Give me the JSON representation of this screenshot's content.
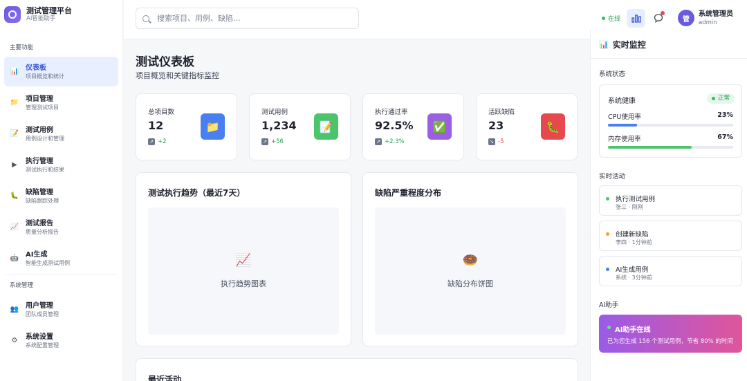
{
  "brand": {
    "title": "测试管理平台",
    "subtitle": "AI智能助手"
  },
  "sidebar": {
    "section_main": "主要功能",
    "section_system": "系统管理",
    "items": [
      {
        "label": "仪表板",
        "desc": "项目概览和统计",
        "icon": "📊",
        "active": true
      },
      {
        "label": "项目管理",
        "desc": "管理测试项目",
        "icon": "📁"
      },
      {
        "label": "测试用例",
        "desc": "用例设计和管理",
        "icon": "📝"
      },
      {
        "label": "执行管理",
        "desc": "测试执行和结果",
        "icon": "▶"
      },
      {
        "label": "缺陷管理",
        "desc": "缺陷跟踪处理",
        "icon": "🐛"
      },
      {
        "label": "测试报告",
        "desc": "质量分析报告",
        "icon": "📈"
      },
      {
        "label": "AI生成",
        "desc": "智能生成测试用例",
        "icon": "🤖"
      }
    ],
    "system_items": [
      {
        "label": "用户管理",
        "desc": "团队成员管理",
        "icon": "👥"
      },
      {
        "label": "系统设置",
        "desc": "系统配置管理",
        "icon": "⚙"
      }
    ]
  },
  "header": {
    "search_placeholder": "搜索项目、用例、缺陷...",
    "status": "在线",
    "user_name": "系统管理员",
    "user_role": "admin",
    "avatar_text": "管"
  },
  "main": {
    "title": "测试仪表板",
    "subtitle": "项目概览和关键指标监控",
    "stats": [
      {
        "label": "总项目数",
        "value": "12",
        "trend": "+2",
        "trend_color": "#2a9b54",
        "icon": "📁",
        "icon_bg": "#4a7ff0"
      },
      {
        "label": "测试用例",
        "value": "1,234",
        "trend": "+56",
        "trend_color": "#2a9b54",
        "icon": "📝",
        "icon_bg": "#4cc46a"
      },
      {
        "label": "执行通过率",
        "value": "92.5%",
        "trend": "+2.3%",
        "trend_color": "#2a9b54",
        "icon": "✅",
        "icon_bg": "#9b5fe6"
      },
      {
        "label": "活跃缺陷",
        "value": "23",
        "trend": "-5",
        "trend_color": "#e5484d",
        "icon": "🐛",
        "icon_bg": "#e5484d"
      }
    ],
    "panels": [
      {
        "title": "测试执行趋势（最近7天）",
        "emoji": "📈",
        "caption": "执行趋势图表"
      },
      {
        "title": "缺陷严重程度分布",
        "emoji": "🍩",
        "caption": "缺陷分布饼图"
      }
    ],
    "recent_title": "最近活动"
  },
  "monitor": {
    "title": "实时监控",
    "system_status_label": "系统状态",
    "health_label": "系统健康",
    "health_status": "正常",
    "cpu_label": "CPU使用率",
    "cpu_value": "23%",
    "cpu_fraction": 0.23,
    "mem_label": "内存使用率",
    "mem_value": "67%",
    "mem_fraction": 0.67,
    "activity_label": "实时活动",
    "activities": [
      {
        "title": "执行测试用例",
        "meta": "张三 · 刚刚",
        "color": "#4cc46a"
      },
      {
        "title": "创建新缺陷",
        "meta": "李四 · 1分钟前",
        "color": "#f0a030"
      },
      {
        "title": "AI生成用例",
        "meta": "系统 · 3分钟前",
        "color": "#4a7ff0"
      }
    ],
    "ai_label": "AI助手",
    "ai_title": "AI助手在线",
    "ai_desc": "已为您生成 156 个测试用例，节省 80% 的时间"
  },
  "colors": {
    "accent": "#3a58d8",
    "success": "#2a9b54",
    "danger": "#e5484d",
    "cpu_bar": "#4a7ff0",
    "mem_bar": "#4cc46a"
  }
}
